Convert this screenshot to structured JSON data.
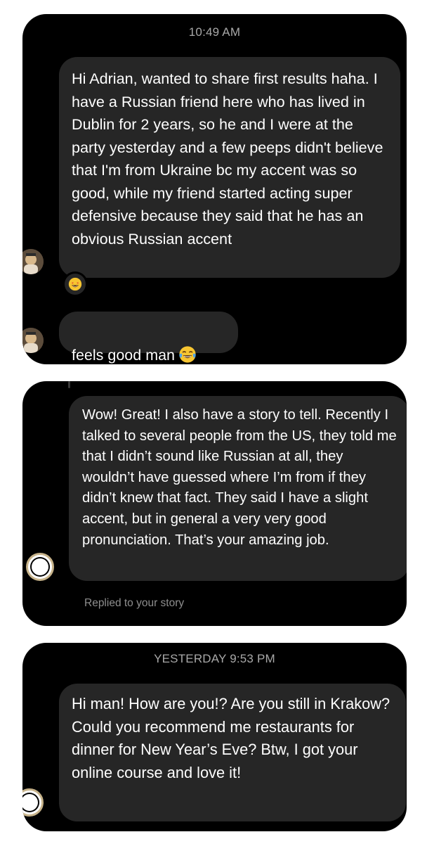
{
  "thread1": {
    "timestamp": "10:49 AM",
    "message1": "Hi Adrian, wanted to share first results haha. I have a Russian friend here who has lived in Dublin for 2 years, so he and I were at the party yesterday and a few peeps didn't believe that I'm from Ukraine bc my accent was so good, while my friend started acting super defensive because they said that he has an obvious Russian accent",
    "reaction_icon": "star-struck-emoji",
    "message2": "feels good man",
    "message2_emoji": "tears-of-joy-emoji",
    "avatar_icon": "profile-avatar"
  },
  "thread2": {
    "message": "Wow! Great! I also have a story to tell. Recently I talked to several people from the US, they told me that I didn’t sound like Russian at all, they wouldn’t have guessed where I’m from if they didn’t knew that fact. They said I have a slight accent, but in general a very very good pronunciation. That’s your amazing job.",
    "reply_note": "Replied to your story",
    "story_icon": "story-reply-avatar"
  },
  "thread3": {
    "timestamp": "YESTERDAY 9:53 PM",
    "message": "Hi man! How are you!? Are you still in Krakow? Could you recommend me restaurants for dinner for New Year’s Eve? Btw, I got your online course and love it!",
    "story_icon": "story-reply-avatar"
  },
  "colors": {
    "card_bg": "#000000",
    "bubble_bg": "#262626",
    "text": "#ffffff",
    "muted": "#a8a8a8"
  }
}
